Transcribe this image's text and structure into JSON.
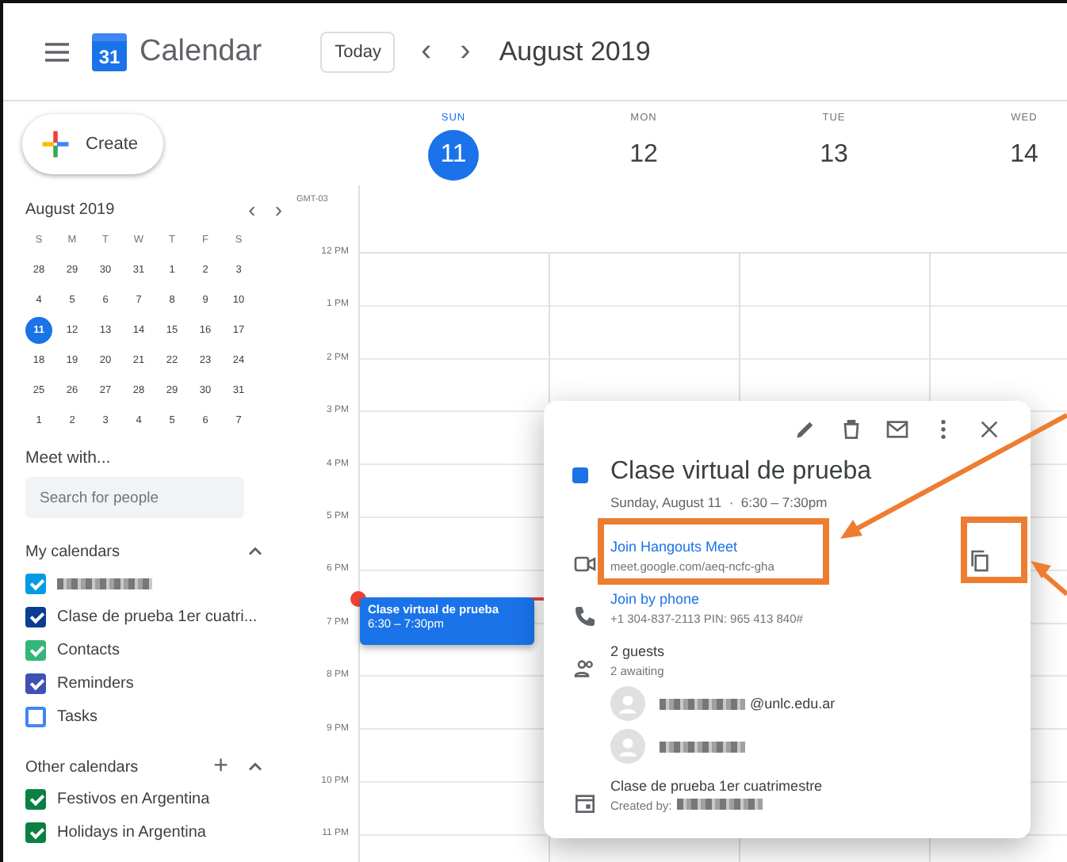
{
  "header": {
    "app_name": "Calendar",
    "logo_day": "31",
    "today_button": "Today",
    "prev": "‹",
    "next": "›",
    "period": "August 2019"
  },
  "create_button": "Create",
  "mini_calendar": {
    "title": "August 2019",
    "weekdays": [
      "S",
      "M",
      "T",
      "W",
      "T",
      "F",
      "S"
    ],
    "weeks": [
      [
        {
          "day": "28",
          "selected": false
        },
        {
          "day": "29",
          "selected": false
        },
        {
          "day": "30",
          "selected": false
        },
        {
          "day": "31",
          "selected": false
        },
        {
          "day": "1",
          "selected": false
        },
        {
          "day": "2",
          "selected": false
        },
        {
          "day": "3",
          "selected": false
        }
      ],
      [
        {
          "day": "4",
          "selected": false
        },
        {
          "day": "5",
          "selected": false
        },
        {
          "day": "6",
          "selected": false
        },
        {
          "day": "7",
          "selected": false
        },
        {
          "day": "8",
          "selected": false
        },
        {
          "day": "9",
          "selected": false
        },
        {
          "day": "10",
          "selected": false
        }
      ],
      [
        {
          "day": "11",
          "selected": true
        },
        {
          "day": "12",
          "selected": false
        },
        {
          "day": "13",
          "selected": false
        },
        {
          "day": "14",
          "selected": false
        },
        {
          "day": "15",
          "selected": false
        },
        {
          "day": "16",
          "selected": false
        },
        {
          "day": "17",
          "selected": false
        }
      ],
      [
        {
          "day": "18",
          "selected": false
        },
        {
          "day": "19",
          "selected": false
        },
        {
          "day": "20",
          "selected": false
        },
        {
          "day": "21",
          "selected": false
        },
        {
          "day": "22",
          "selected": false
        },
        {
          "day": "23",
          "selected": false
        },
        {
          "day": "24",
          "selected": false
        }
      ],
      [
        {
          "day": "25",
          "selected": false
        },
        {
          "day": "26",
          "selected": false
        },
        {
          "day": "27",
          "selected": false
        },
        {
          "day": "28",
          "selected": false
        },
        {
          "day": "29",
          "selected": false
        },
        {
          "day": "30",
          "selected": false
        },
        {
          "day": "31",
          "selected": false
        }
      ],
      [
        {
          "day": "1",
          "selected": false
        },
        {
          "day": "2",
          "selected": false
        },
        {
          "day": "3",
          "selected": false
        },
        {
          "day": "4",
          "selected": false
        },
        {
          "day": "5",
          "selected": false
        },
        {
          "day": "6",
          "selected": false
        },
        {
          "day": "7",
          "selected": false
        }
      ]
    ]
  },
  "meet_with": {
    "title": "Meet with...",
    "placeholder": "Search for people"
  },
  "my_calendars": {
    "title": "My calendars",
    "expanded": true,
    "items": [
      {
        "kind": "redacted",
        "checked": true,
        "color": "#039be5"
      },
      {
        "kind": "named",
        "name": "Clase de prueba 1er cuatri...",
        "checked": true,
        "color": "#0b3d91"
      },
      {
        "kind": "named",
        "name": "Contacts",
        "checked": true,
        "color": "#33b679"
      },
      {
        "kind": "named",
        "name": "Reminders",
        "checked": true,
        "color": "#3f51b5"
      },
      {
        "kind": "named",
        "name": "Tasks",
        "checked": false,
        "color": "#4285f4"
      }
    ]
  },
  "other_calendars": {
    "title": "Other calendars",
    "add": "+",
    "expanded": true,
    "items": [
      {
        "kind": "named",
        "name": "Festivos en Argentina",
        "checked": true,
        "color": "#0b8043"
      },
      {
        "kind": "named",
        "name": "Holidays in Argentina",
        "checked": true,
        "color": "#0b8043"
      }
    ]
  },
  "week": {
    "timezone": "GMT-03",
    "days": [
      {
        "weekday": "SUN",
        "date": "11",
        "selected": true
      },
      {
        "weekday": "MON",
        "date": "12",
        "selected": false
      },
      {
        "weekday": "TUE",
        "date": "13",
        "selected": false
      },
      {
        "weekday": "WED",
        "date": "14",
        "selected": false
      }
    ],
    "hours": [
      "12 PM",
      "1 PM",
      "2 PM",
      "3 PM",
      "4 PM",
      "5 PM",
      "6 PM",
      "7 PM",
      "8 PM",
      "9 PM",
      "10 PM",
      "11 PM"
    ]
  },
  "event": {
    "title": "Clase virtual de prueba",
    "time": "6:30 – 7:30pm",
    "color": "#1a73e8"
  },
  "popup": {
    "title": "Clase virtual de prueba",
    "color": "#1a73e8",
    "when": "Sunday, August 11  ·  6:30 – 7:30pm",
    "meet_link": "Join Hangouts Meet",
    "meet_url": "meet.google.com/aeq-ncfc-gha",
    "phone_link": "Join by phone",
    "phone_detail": "+1 304-837-2113 PIN: 965 413 840#",
    "guests": "2 guests",
    "guests_status": "2 awaiting",
    "guest_list": [
      {
        "kind": "partial",
        "visible": "@unlc.edu.ar"
      },
      {
        "kind": "redacted"
      }
    ],
    "calendar": "Clase de prueba 1er cuatrimestre",
    "created_by": "Created by:"
  }
}
